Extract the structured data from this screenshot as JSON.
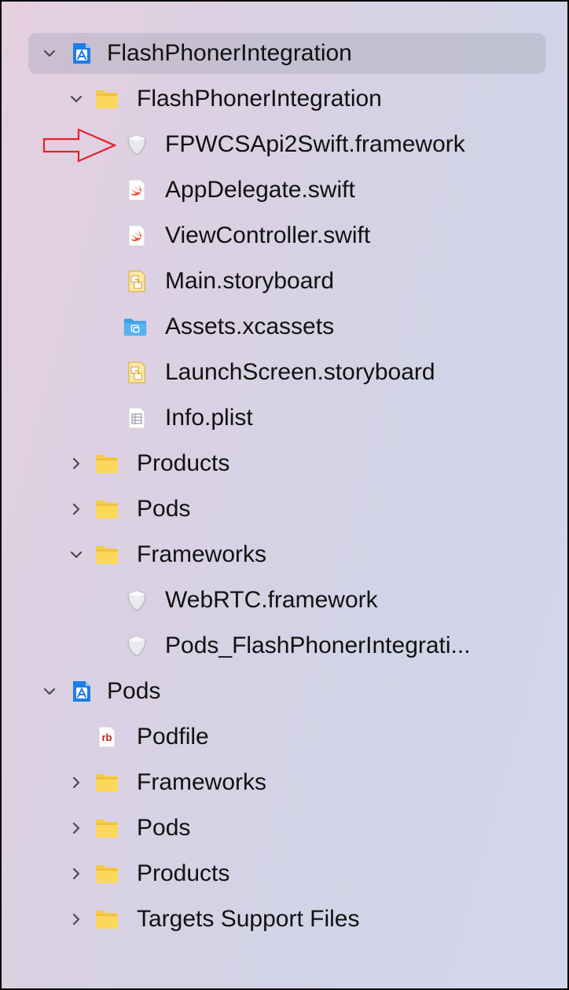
{
  "tree": {
    "items": [
      {
        "label": "FlashPhonerIntegration",
        "icon": "xcode-project-icon",
        "disclosure": "expanded"
      },
      {
        "label": "FlashPhonerIntegration",
        "icon": "folder-icon",
        "disclosure": "expanded"
      },
      {
        "label": "FPWCSApi2Swift.framework",
        "icon": "framework-icon"
      },
      {
        "label": "AppDelegate.swift",
        "icon": "swift-file-icon"
      },
      {
        "label": "ViewController.swift",
        "icon": "swift-file-icon"
      },
      {
        "label": "Main.storyboard",
        "icon": "storyboard-icon"
      },
      {
        "label": "Assets.xcassets",
        "icon": "asset-catalog-icon"
      },
      {
        "label": "LaunchScreen.storyboard",
        "icon": "storyboard-icon"
      },
      {
        "label": "Info.plist",
        "icon": "plist-icon"
      },
      {
        "label": "Products",
        "icon": "folder-icon",
        "disclosure": "collapsed"
      },
      {
        "label": "Pods",
        "icon": "folder-icon",
        "disclosure": "collapsed"
      },
      {
        "label": "Frameworks",
        "icon": "folder-icon",
        "disclosure": "expanded"
      },
      {
        "label": "WebRTC.framework",
        "icon": "framework-icon"
      },
      {
        "label": "Pods_FlashPhonerIntegrati...",
        "icon": "framework-icon"
      },
      {
        "label": "Pods",
        "icon": "xcode-project-icon",
        "disclosure": "expanded"
      },
      {
        "label": "Podfile",
        "icon": "ruby-file-icon",
        "icon_text": "rb"
      },
      {
        "label": "Frameworks",
        "icon": "folder-icon",
        "disclosure": "collapsed"
      },
      {
        "label": "Pods",
        "icon": "folder-icon",
        "disclosure": "collapsed"
      },
      {
        "label": "Products",
        "icon": "folder-icon",
        "disclosure": "collapsed"
      },
      {
        "label": "Targets Support Files",
        "icon": "folder-icon",
        "disclosure": "collapsed"
      }
    ]
  },
  "annotation": {
    "icon": "red-outline-arrow-icon",
    "color": "#e8202a"
  },
  "colors": {
    "folder": "#f7c948",
    "project_blue": "#1f7de6",
    "swift_orange": "#f05138",
    "selection": "#b5b5c6"
  }
}
